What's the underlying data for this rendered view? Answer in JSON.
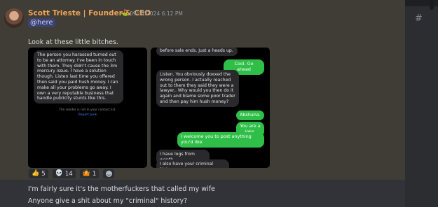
{
  "channel": {
    "hash": "#"
  },
  "message": {
    "author": "Scott Trieste | Founder & CEO",
    "timestamp": "09/07/2024 6:12 PM",
    "mention": "@here",
    "text": "Look at these little bitches."
  },
  "left_screenshot": {
    "bubble": "The person you harassed turned out to be an attorney. I've been in touch with them. They didn't cause the 3m mercury issue. I have a solution though. Listen last time you offered then said you paid hush money. I can make all your problems go away. I own a very reputable business that handle publicity stunts like this.",
    "notice": "The sender is not in your contact list.",
    "report": "Report Junk"
  },
  "right_screenshot": {
    "messages": [
      {
        "side": "left",
        "text": "before sale ends. Just a heads up."
      },
      {
        "side": "right",
        "text": "Cool. Go ahead"
      },
      {
        "side": "left",
        "text": "Listen. You obviously doxxed the wrong person. I actually reached out to them they said they were a lawyer.. Why would you then do it again and blame some poor trader and then pay him hush money?"
      },
      {
        "side": "right",
        "text": "Abshaha."
      },
      {
        "side": "right",
        "text": "You are a joke."
      },
      {
        "side": "right",
        "text": "I welcome you to post anything you'd like"
      },
      {
        "side": "left",
        "text": "I have logs from wepth."
      },
      {
        "side": "left",
        "text": "I also have your criminal history"
      }
    ]
  },
  "reactions": [
    {
      "emoji": "thumbs-up",
      "count": "5"
    },
    {
      "emoji": "skull",
      "count": "14"
    },
    {
      "emoji": "person-shrug",
      "count": "1"
    }
  ],
  "followups": [
    "I'm fairly sure it's the motherfuckers that called my wife",
    "Anyone give a shit about my \"criminal\" history?"
  ]
}
